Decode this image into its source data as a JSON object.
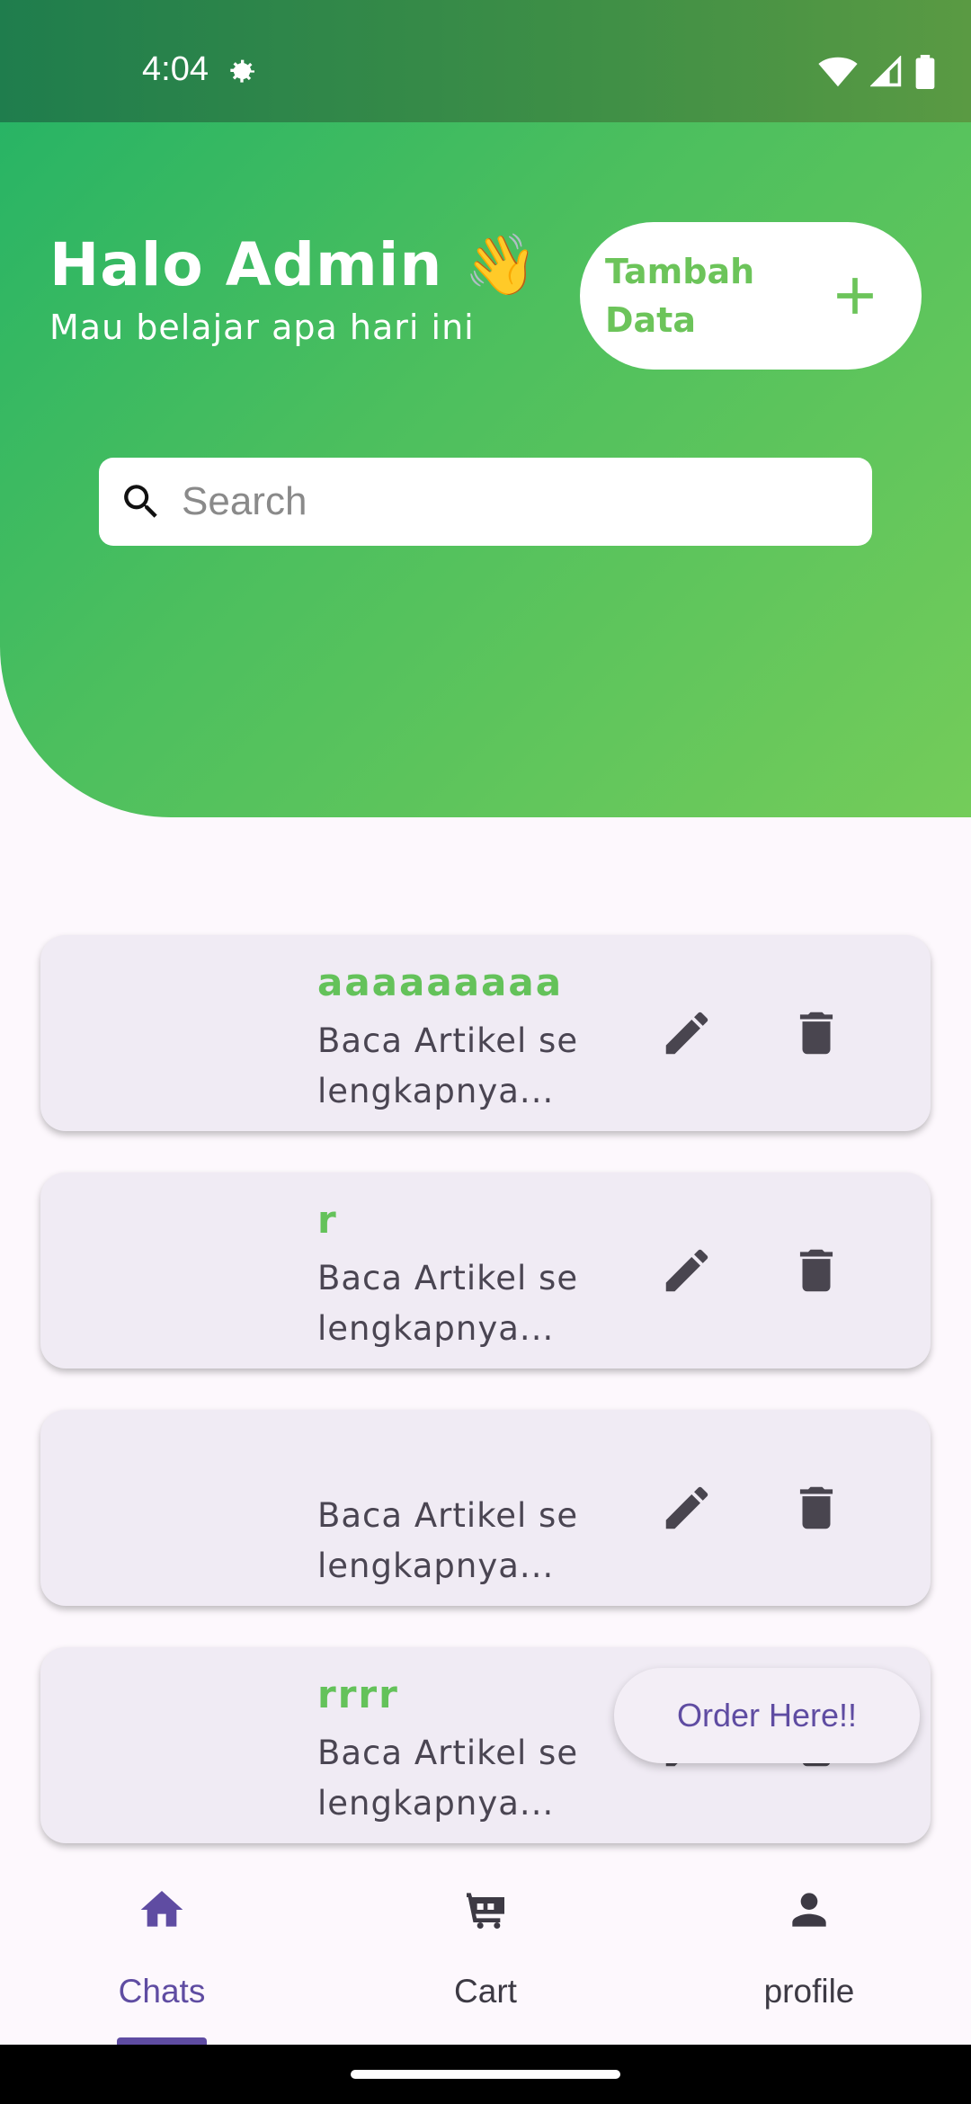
{
  "status_bar": {
    "time": "4:04",
    "icons": [
      "settings-icon",
      "wifi-icon",
      "cellular-icon",
      "battery-icon"
    ]
  },
  "header": {
    "greeting_title": "Halo Admin 👋",
    "greeting_subtitle": "Mau belajar apa hari ini",
    "add_button_label": "Tambah Data",
    "add_button_icon": "plus-icon",
    "accent_color": "#6cc45a"
  },
  "search": {
    "placeholder": "Search",
    "value": ""
  },
  "articles": [
    {
      "title": "aaaaaaaaa",
      "description": "Baca Artikel se lengkapnya..."
    },
    {
      "title": "r",
      "description": "Baca Artikel se lengkapnya..."
    },
    {
      "title": "",
      "description": "Baca Artikel se lengkapnya..."
    },
    {
      "title": "rrrr",
      "description": "Baca Artikel se lengkapnya..."
    }
  ],
  "fab": {
    "label": "Order Here!!"
  },
  "bottom_nav": {
    "items": [
      {
        "label": "Chats",
        "icon": "home-icon",
        "active": true
      },
      {
        "label": "Cart",
        "icon": "cart-icon",
        "active": false
      },
      {
        "label": "profile",
        "icon": "person-icon",
        "active": false
      }
    ],
    "active_color": "#5f4ca2"
  }
}
